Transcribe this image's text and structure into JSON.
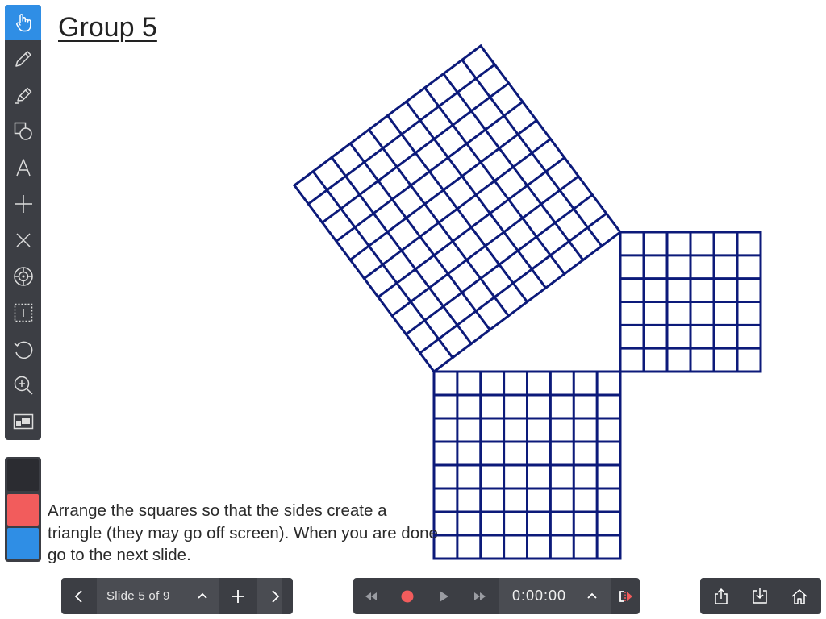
{
  "page": {
    "title": "Group 5",
    "instructions": "Arrange the squares so that the sides create a triangle (they may go off screen). When you are done go to the next slide."
  },
  "toolbar": {
    "tools": [
      {
        "name": "hand-tool",
        "icon": "hand-icon",
        "active": true
      },
      {
        "name": "pen-tool",
        "icon": "pencil-icon"
      },
      {
        "name": "highlighter-tool",
        "icon": "highlighter-icon"
      },
      {
        "name": "shapes-tool",
        "icon": "shapes-icon"
      },
      {
        "name": "text-tool",
        "icon": "text-a-icon"
      },
      {
        "name": "add-tool",
        "icon": "plus-icon"
      },
      {
        "name": "delete-tool",
        "icon": "x-icon"
      },
      {
        "name": "pointer-tool",
        "icon": "crosshair-icon"
      },
      {
        "name": "select-tool",
        "icon": "dotted-select-icon"
      },
      {
        "name": "undo-tool",
        "icon": "undo-icon"
      },
      {
        "name": "zoom-tool",
        "icon": "zoom-in-icon"
      },
      {
        "name": "background-tool",
        "icon": "window-icon"
      }
    ]
  },
  "palette": {
    "colors": [
      "#2b2c31",
      "#f25c5c",
      "#2f8ee5"
    ]
  },
  "slide_nav": {
    "label": "Slide 5 of 9",
    "prev_icon": "chevron-left-icon",
    "expand_icon": "chevron-up-icon",
    "add_icon": "plus-icon",
    "next_icon": "chevron-right-icon"
  },
  "recorder": {
    "time": "0:00:00",
    "rewind_icon": "rewind-icon",
    "record_icon": "record-icon",
    "play_icon": "play-icon",
    "forward_icon": "fast-forward-icon",
    "expand_icon": "chevron-up-icon",
    "trim_icon": "trim-icon",
    "record_color": "#f25c5c"
  },
  "actions": {
    "share_icon": "share-icon",
    "save_icon": "save-icon",
    "home_icon": "home-icon"
  },
  "grids": {
    "line_color": "#0c1a7a",
    "squares": [
      {
        "name": "large-grid-square",
        "cells": 10
      },
      {
        "name": "medium-grid-square",
        "cells": 8
      },
      {
        "name": "small-grid-square",
        "cells": 6
      }
    ]
  }
}
